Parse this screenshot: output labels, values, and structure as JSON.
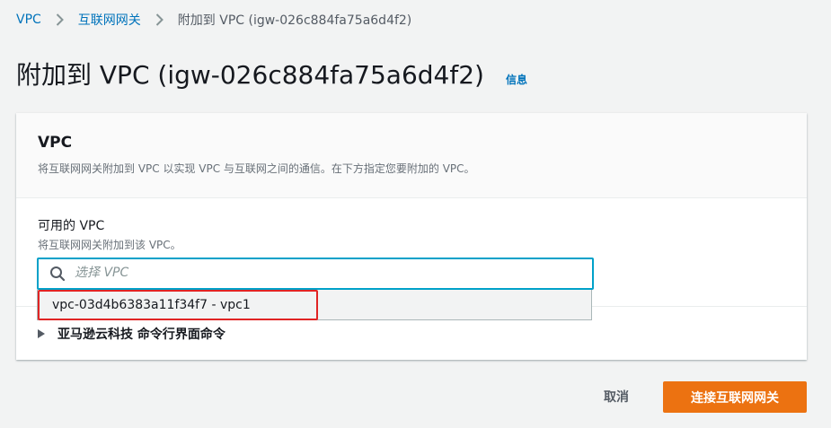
{
  "breadcrumb": {
    "items": [
      "VPC",
      "互联网网关",
      "附加到 VPC (igw-026c884fa75a6d4f2)"
    ]
  },
  "page": {
    "title": "附加到 VPC (igw-026c884fa75a6d4f2)",
    "info_link": "信息"
  },
  "panel": {
    "title": "VPC",
    "description": "将互联网网关附加到 VPC 以实现 VPC 与互联网之间的通信。在下方指定您要附加的 VPC。",
    "field_label": "可用的 VPC",
    "field_description": "将互联网网关附加到该 VPC。",
    "search_placeholder": "选择 VPC",
    "search_value": "",
    "options": [
      "vpc-03d4b6383a11f34f7 - vpc1"
    ],
    "expander_label": "亚马逊云科技 命令行界面命令"
  },
  "actions": {
    "cancel_label": "取消",
    "submit_label": "连接互联网网关"
  },
  "colors": {
    "link": "#0073bb",
    "primary": "#ec7211",
    "focus": "#00a1c9",
    "highlight": "#e02424"
  },
  "icons": [
    "chevron-right-icon",
    "search-icon",
    "caret-right-icon"
  ]
}
